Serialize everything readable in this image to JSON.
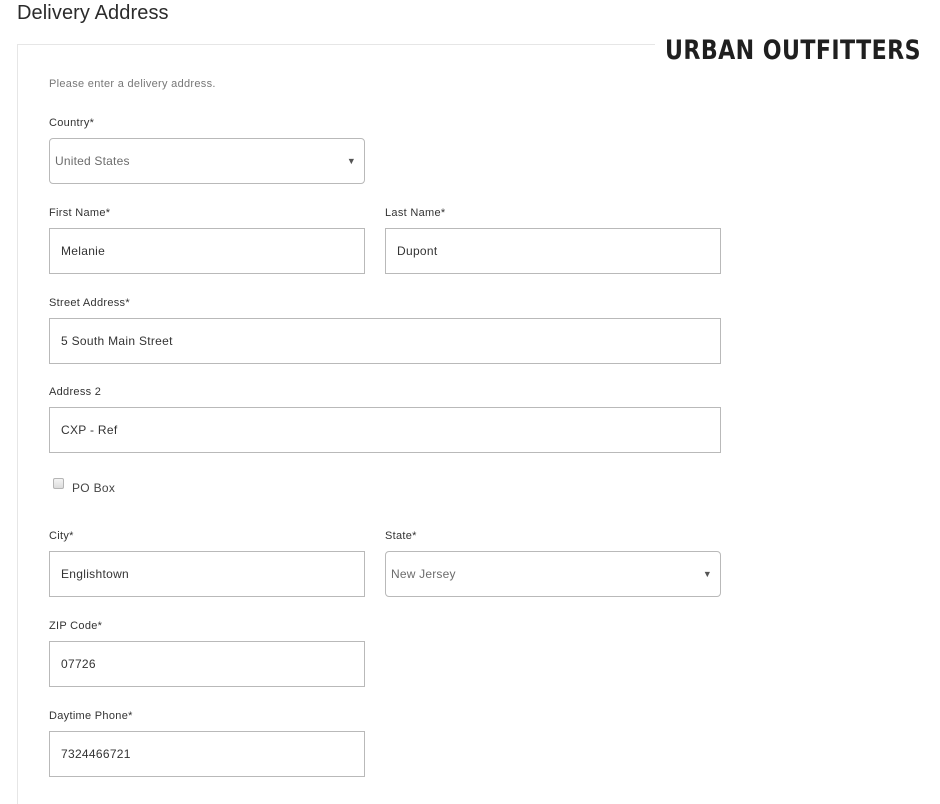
{
  "page": {
    "title": "Delivery Address",
    "intro": "Please enter a delivery address."
  },
  "brand": {
    "logo_text": "URBAN OUTFITTERS"
  },
  "form": {
    "country": {
      "label": "Country*",
      "value": "United States",
      "icon": "caret-down-icon"
    },
    "first_name": {
      "label": "First Name*",
      "value": "Melanie"
    },
    "last_name": {
      "label": "Last Name*",
      "value": "Dupont"
    },
    "street_address": {
      "label": "Street Address*",
      "value": "5 South Main Street"
    },
    "address_2": {
      "label": "Address 2",
      "value": "CXP - Ref"
    },
    "po_box": {
      "label": "PO Box",
      "checked": false
    },
    "city": {
      "label": "City*",
      "value": "Englishtown"
    },
    "state": {
      "label": "State*",
      "value": "New Jersey",
      "icon": "caret-down-icon"
    },
    "zip": {
      "label": "ZIP Code*",
      "value": "07726"
    },
    "phone": {
      "label": "Daytime Phone*",
      "value": "7324466721"
    },
    "caret_glyph": "▼"
  }
}
